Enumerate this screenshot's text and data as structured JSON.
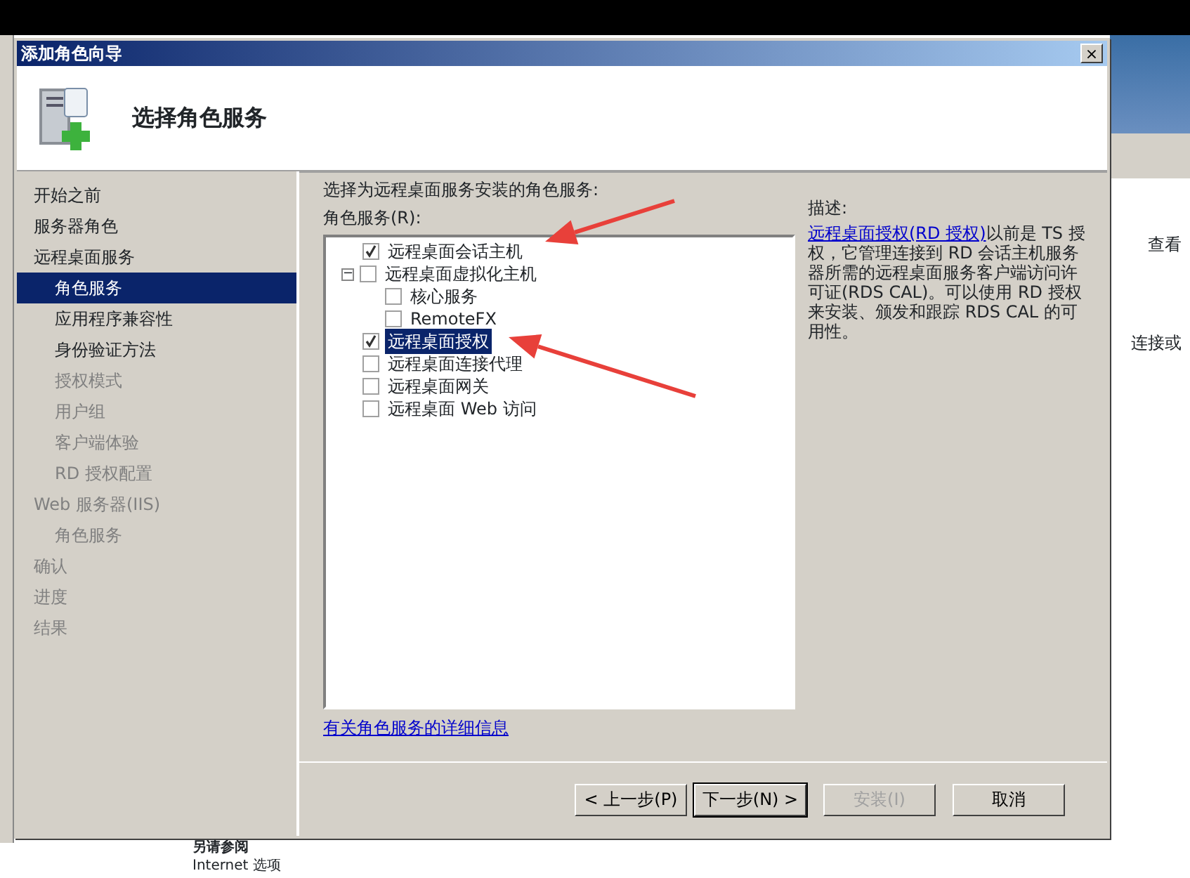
{
  "window": {
    "title": "添加角色向导",
    "close": "×"
  },
  "header": {
    "title": "选择角色服务"
  },
  "sidebar": {
    "items": [
      {
        "label": "开始之前",
        "selected": false,
        "disabled": false
      },
      {
        "label": "服务器角色",
        "selected": false,
        "disabled": false
      },
      {
        "label": "远程桌面服务",
        "selected": false,
        "disabled": false,
        "children": [
          {
            "label": "角色服务",
            "selected": true,
            "disabled": false
          },
          {
            "label": "应用程序兼容性",
            "selected": false,
            "disabled": false
          },
          {
            "label": "身份验证方法",
            "selected": false,
            "disabled": false
          },
          {
            "label": "授权模式",
            "selected": false,
            "disabled": true
          },
          {
            "label": "用户组",
            "selected": false,
            "disabled": true
          },
          {
            "label": "客户端体验",
            "selected": false,
            "disabled": true
          },
          {
            "label": "RD 授权配置",
            "selected": false,
            "disabled": true
          }
        ]
      },
      {
        "label": "Web 服务器(IIS)",
        "selected": false,
        "disabled": true,
        "children": [
          {
            "label": "角色服务",
            "selected": false,
            "disabled": true
          }
        ]
      },
      {
        "label": "确认",
        "selected": false,
        "disabled": true
      },
      {
        "label": "进度",
        "selected": false,
        "disabled": true
      },
      {
        "label": "结果",
        "selected": false,
        "disabled": true
      }
    ]
  },
  "instruction": "选择为远程桌面服务安装的角色服务:",
  "list_label": "角色服务(R):",
  "role_services": [
    {
      "label": "远程桌面会话主机",
      "checked": true,
      "selected": false
    },
    {
      "label": "远程桌面虚拟化主机",
      "checked": false,
      "selected": false,
      "expanded": true,
      "toggle": "−",
      "children": [
        {
          "label": "核心服务",
          "checked": false,
          "selected": false
        },
        {
          "label": "RemoteFX",
          "checked": false,
          "selected": false
        }
      ]
    },
    {
      "label": "远程桌面授权",
      "checked": true,
      "selected": true
    },
    {
      "label": "远程桌面连接代理",
      "checked": false,
      "selected": false
    },
    {
      "label": "远程桌面网关",
      "checked": false,
      "selected": false
    },
    {
      "label": "远程桌面 Web 访问",
      "checked": false,
      "selected": false
    }
  ],
  "description": {
    "label": "描述:",
    "link": "远程桌面授权(RD 授权)",
    "text": "以前是 TS 授权，它管理连接到 RD 会话主机服务器所需的远程桌面服务客户端访问许可证(RDS CAL)。可以使用 RD 授权来安装、颁发和跟踪 RDS CAL 的可用性。"
  },
  "more_info_link": "有关角色服务的详细信息",
  "buttons": [
    {
      "label": "< 上一步(P)",
      "disabled": false,
      "default": false
    },
    {
      "label": "下一步(N) >",
      "disabled": false,
      "default": true
    },
    {
      "label": "安装(I)",
      "disabled": true,
      "default": false
    },
    {
      "label": "取消",
      "disabled": false,
      "default": false
    }
  ],
  "background_window": {
    "texts": [
      "查看",
      "连接或"
    ],
    "see_also": "另请参阅",
    "bottom_link": "Internet 选项"
  }
}
